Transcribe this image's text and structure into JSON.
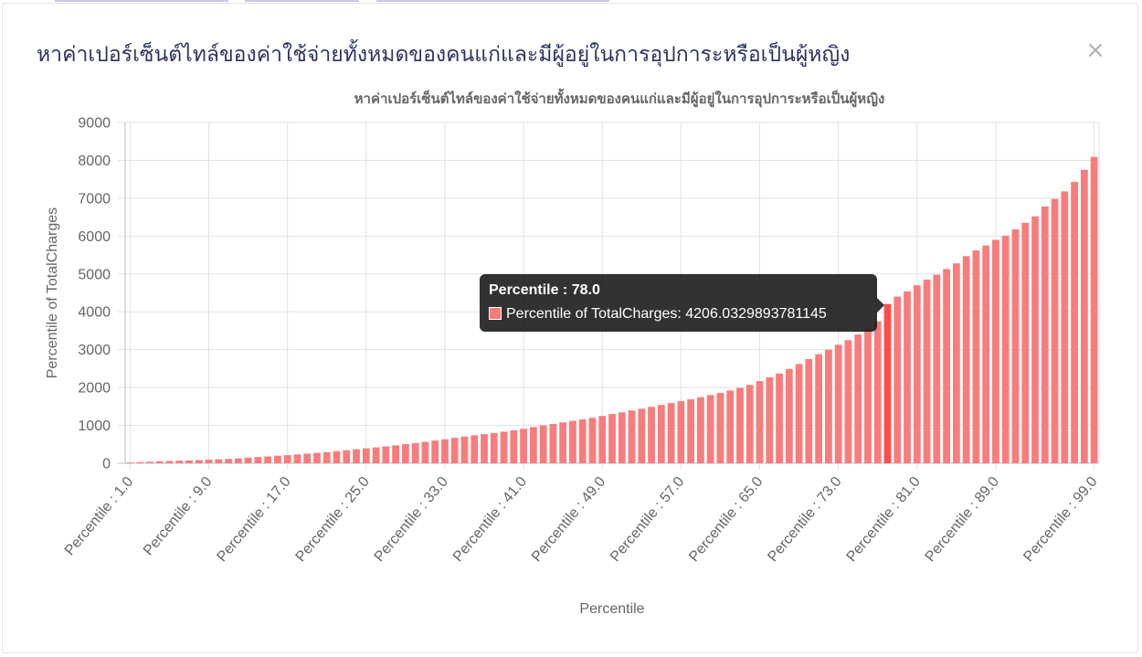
{
  "modal": {
    "title": "หาค่าเปอร์เซ็นต์ไทล์ของค่าใช้จ่ายทั้งหมดของคนแก่และมีผู้อยู่ในการอุปการะหรือเป็นผู้หญิง",
    "close_label": "×"
  },
  "chart_data": {
    "type": "bar",
    "title": "หาค่าเปอร์เซ็นต์ไทล์ของค่าใช้จ่ายทั้งหมดของคนแก่และมีผู้อยู่ในการอุปการะหรือเป็นผู้หญิง",
    "xlabel": "Percentile",
    "ylabel": "Percentile of TotalCharges",
    "ylim": [
      0,
      9000
    ],
    "y_ticks": [
      0,
      1000,
      2000,
      3000,
      4000,
      5000,
      6000,
      7000,
      8000,
      9000
    ],
    "x_tick_labels": [
      "Percentile : 1.0",
      "Percentile : 9.0",
      "Percentile : 17.0",
      "Percentile : 25.0",
      "Percentile : 33.0",
      "Percentile : 41.0",
      "Percentile : 49.0",
      "Percentile : 57.0",
      "Percentile : 65.0",
      "Percentile : 73.0",
      "Percentile : 81.0",
      "Percentile : 89.0",
      "Percentile : 99.0"
    ],
    "grid": true,
    "bar_color": "#f87c7c",
    "highlight_color": "#ff4d4d",
    "highlight_index": 77,
    "categories": [
      "Percentile : 1.0",
      "Percentile : 2.0",
      "Percentile : 3.0",
      "Percentile : 4.0",
      "Percentile : 5.0",
      "Percentile : 6.0",
      "Percentile : 7.0",
      "Percentile : 8.0",
      "Percentile : 9.0",
      "Percentile : 10.0",
      "Percentile : 11.0",
      "Percentile : 12.0",
      "Percentile : 13.0",
      "Percentile : 14.0",
      "Percentile : 15.0",
      "Percentile : 16.0",
      "Percentile : 17.0",
      "Percentile : 18.0",
      "Percentile : 19.0",
      "Percentile : 20.0",
      "Percentile : 21.0",
      "Percentile : 22.0",
      "Percentile : 23.0",
      "Percentile : 24.0",
      "Percentile : 25.0",
      "Percentile : 26.0",
      "Percentile : 27.0",
      "Percentile : 28.0",
      "Percentile : 29.0",
      "Percentile : 30.0",
      "Percentile : 31.0",
      "Percentile : 32.0",
      "Percentile : 33.0",
      "Percentile : 34.0",
      "Percentile : 35.0",
      "Percentile : 36.0",
      "Percentile : 37.0",
      "Percentile : 38.0",
      "Percentile : 39.0",
      "Percentile : 40.0",
      "Percentile : 41.0",
      "Percentile : 42.0",
      "Percentile : 43.0",
      "Percentile : 44.0",
      "Percentile : 45.0",
      "Percentile : 46.0",
      "Percentile : 47.0",
      "Percentile : 48.0",
      "Percentile : 49.0",
      "Percentile : 50.0",
      "Percentile : 51.0",
      "Percentile : 52.0",
      "Percentile : 53.0",
      "Percentile : 54.0",
      "Percentile : 55.0",
      "Percentile : 56.0",
      "Percentile : 57.0",
      "Percentile : 58.0",
      "Percentile : 59.0",
      "Percentile : 60.0",
      "Percentile : 61.0",
      "Percentile : 62.0",
      "Percentile : 63.0",
      "Percentile : 64.0",
      "Percentile : 65.0",
      "Percentile : 66.0",
      "Percentile : 67.0",
      "Percentile : 68.0",
      "Percentile : 69.0",
      "Percentile : 70.0",
      "Percentile : 71.0",
      "Percentile : 72.0",
      "Percentile : 73.0",
      "Percentile : 74.0",
      "Percentile : 75.0",
      "Percentile : 76.0",
      "Percentile : 77.0",
      "Percentile : 78.0",
      "Percentile : 79.0",
      "Percentile : 80.0",
      "Percentile : 81.0",
      "Percentile : 82.0",
      "Percentile : 83.0",
      "Percentile : 84.0",
      "Percentile : 85.0",
      "Percentile : 86.0",
      "Percentile : 87.0",
      "Percentile : 88.0",
      "Percentile : 89.0",
      "Percentile : 90.0",
      "Percentile : 91.0",
      "Percentile : 92.0",
      "Percentile : 93.0",
      "Percentile : 94.0",
      "Percentile : 95.0",
      "Percentile : 96.0",
      "Percentile : 97.0",
      "Percentile : 98.0",
      "Percentile : 99.0"
    ],
    "series": [
      {
        "name": "Percentile of TotalCharges",
        "values": [
          20,
          30,
          40,
          50,
          60,
          70,
          75,
          85,
          95,
          105,
          115,
          130,
          150,
          165,
          180,
          200,
          215,
          235,
          255,
          275,
          295,
          320,
          345,
          370,
          395,
          420,
          445,
          475,
          505,
          535,
          565,
          600,
          635,
          670,
          705,
          740,
          770,
          800,
          835,
          870,
          910,
          955,
          1000,
          1040,
          1080,
          1120,
          1160,
          1200,
          1250,
          1300,
          1345,
          1395,
          1440,
          1490,
          1540,
          1590,
          1640,
          1690,
          1745,
          1800,
          1855,
          1920,
          1990,
          2070,
          2170,
          2270,
          2370,
          2490,
          2620,
          2750,
          2880,
          3000,
          3130,
          3250,
          3400,
          3550,
          3750,
          4206.0329893781145,
          4400,
          4540,
          4700,
          4850,
          4980,
          5130,
          5280,
          5470,
          5620,
          5750,
          5900,
          6010,
          6180,
          6350,
          6520,
          6780,
          6980,
          7180,
          7430,
          7750,
          8090
        ]
      }
    ]
  },
  "tooltip": {
    "title": "Percentile : 78.0",
    "label": "Percentile of TotalCharges: 4206.0329893781145"
  }
}
